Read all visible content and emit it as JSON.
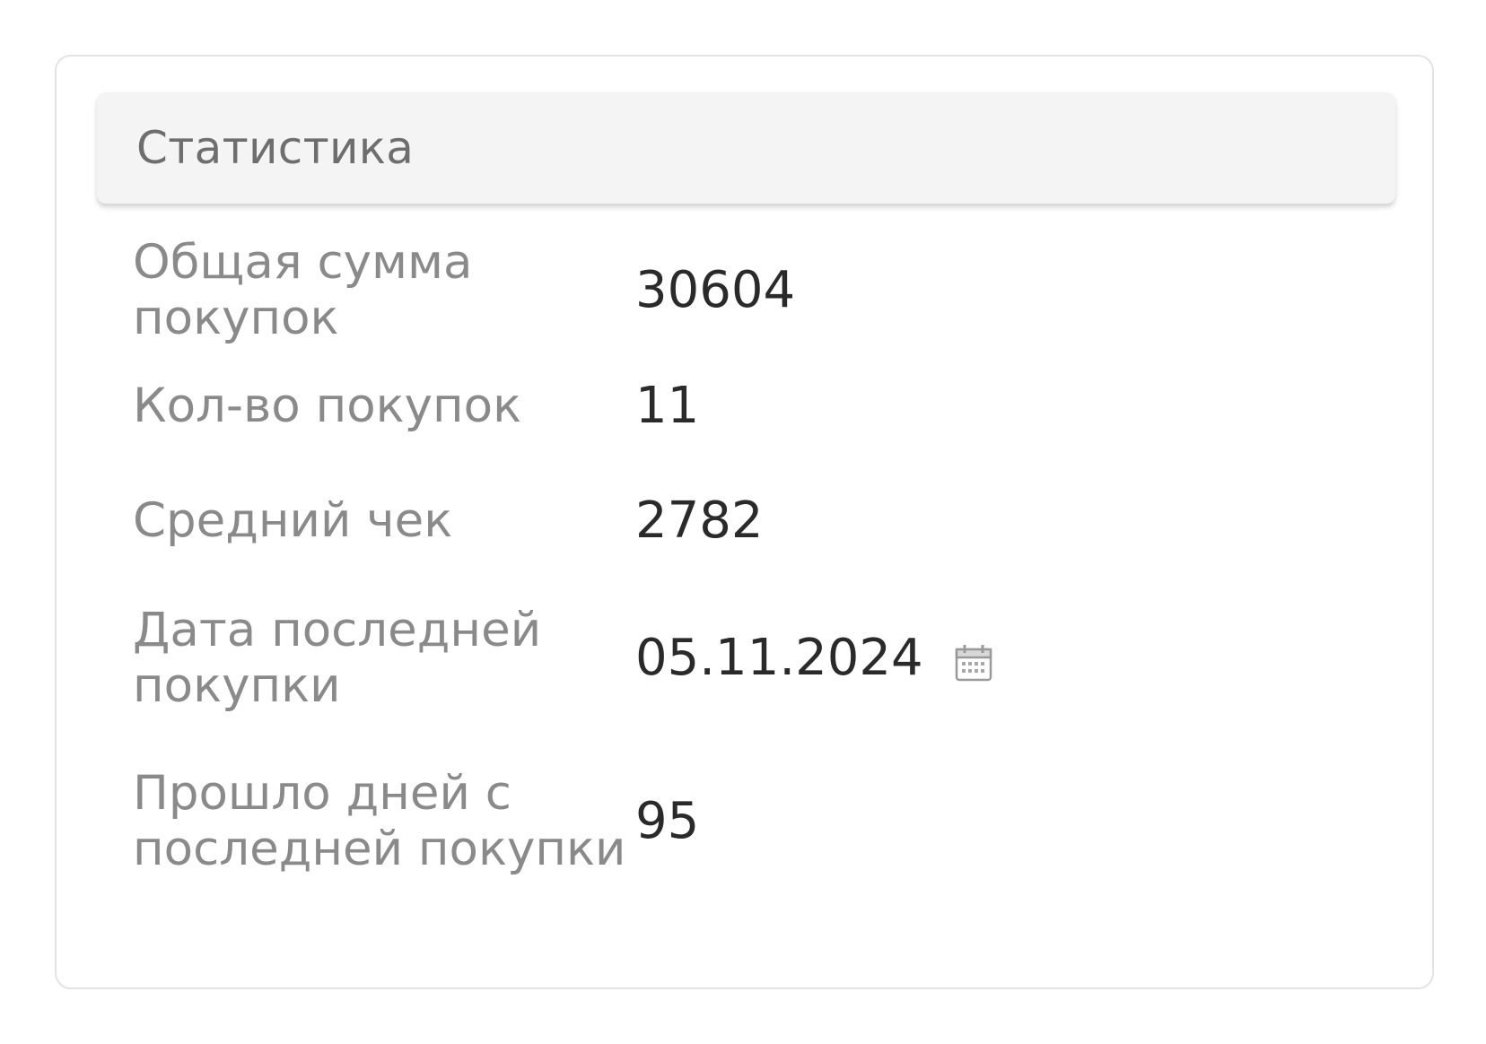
{
  "panel": {
    "title": "Статистика"
  },
  "stats": [
    {
      "label": "Общая сумма покупок",
      "value": "30604"
    },
    {
      "label": "Кол-во покупок",
      "value": "11"
    },
    {
      "label": "Средний чек",
      "value": "2782"
    },
    {
      "label": "Дата последней покупки",
      "value": "05.11.2024",
      "icon": "calendar-icon"
    },
    {
      "label": "Прошло дней с последней покупки",
      "value": "95"
    }
  ],
  "colors": {
    "label": "#8a8a8a",
    "value": "#2a2a2a",
    "header_bg": "#f4f4f4",
    "icon": "#9a9a9a"
  }
}
